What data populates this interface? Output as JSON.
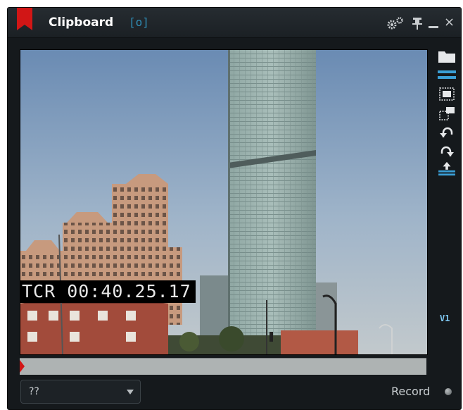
{
  "window": {
    "title": "Clipboard",
    "badge": "[o]"
  },
  "titlebar_icons": [
    "gear-icon",
    "pin-icon",
    "minimize-icon",
    "close-icon"
  ],
  "close_glyph": "×",
  "video": {
    "timecode": "TCR 00:40.25.17"
  },
  "side_toolbar": [
    "folder-icon",
    "list-icon",
    "frame-icon",
    "window-icon",
    "undo-icon",
    "redo-icon",
    "upload-icon"
  ],
  "track_label": "V1",
  "timeline": {
    "position": 0.0
  },
  "select": {
    "value": "??"
  },
  "record_label": "Record",
  "colors": {
    "accent": "#2f8fb8",
    "bookmark": "#d11616",
    "track": "#7ec6f0"
  }
}
